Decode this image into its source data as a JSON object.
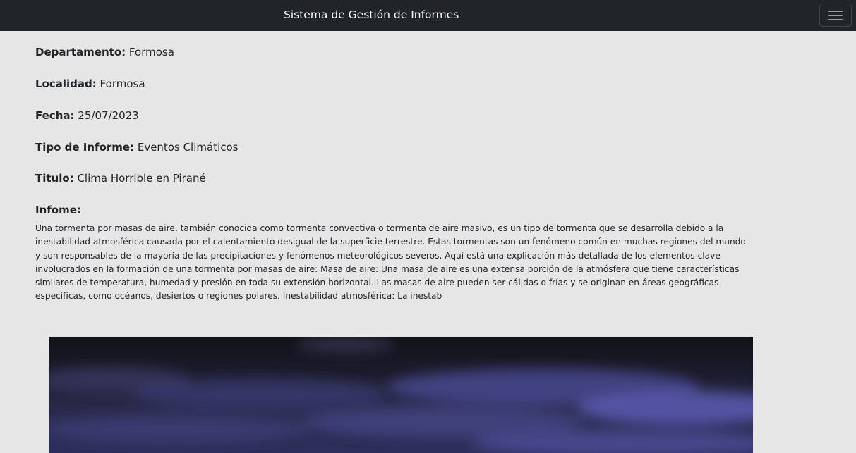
{
  "navbar": {
    "brand": "Sistema de Gestión de Informes",
    "toggler_icon": "menu-icon"
  },
  "report": {
    "departamento": {
      "label": "Departamento:",
      "value": "Formosa"
    },
    "localidad": {
      "label": "Localidad:",
      "value": "Formosa"
    },
    "fecha": {
      "label": "Fecha:",
      "value": "25/07/2023"
    },
    "tipo": {
      "label": "Tipo de Informe:",
      "value": "Eventos Climáticos"
    },
    "titulo": {
      "label": "Titulo:",
      "value": "Clima Horrible en Pirané"
    },
    "informe_label": "Infome:",
    "informe_text": "Una tormenta por masas de aire, también conocida como tormenta convectiva o tormenta de aire masivo, es un tipo de tormenta que se desarrolla debido a la inestabilidad atmosférica causada por el calentamiento desigual de la superficie terrestre. Estas tormentas son un fenómeno común en muchas regiones del mundo y son responsables de la mayoría de las precipitaciones y fenómenos meteorológicos severos. Aquí está una explicación más detallada de los elementos clave involucrados en la formación de una tormenta por masas de aire: Masa de aire: Una masa de aire es una extensa porción de la atmósfera que tiene características similares de temperatura, humedad y presión en toda su extensión horizontal. Las masas de aire pueden ser cálidas o frías y se originan en áreas geográficas específicas, como océanos, desiertos o regiones polares. Inestabilidad atmosférica: La inestab"
  },
  "colors": {
    "navbar_bg": "#212529",
    "page_bg": "#e6e6e6",
    "storm_purple": "#5a5aa8"
  }
}
